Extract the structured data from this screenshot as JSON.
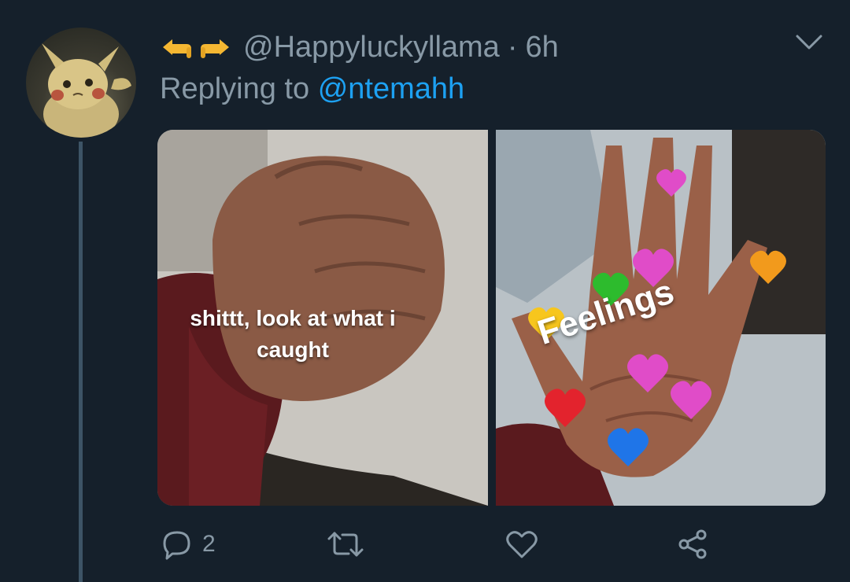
{
  "tweet": {
    "handle": "@Happyluckyllama",
    "separator": "·",
    "time": "6h",
    "replying_prefix": "Replying to",
    "replying_to": "@ntemahh",
    "avatar_icon": "pikachu-avatar",
    "emoji": "pointing-hands-emoji"
  },
  "media": {
    "left_caption": "shittt, look at what i caught",
    "right_caption": "Feelings"
  },
  "actions": {
    "reply_count": "2",
    "reply_icon": "reply-icon",
    "retweet_icon": "retweet-icon",
    "like_icon": "heart-icon",
    "share_icon": "share-icon"
  },
  "colors": {
    "background": "#15202b",
    "muted_text": "#8899a6",
    "link": "#1da1f2",
    "thread_line": "#3d5466"
  }
}
